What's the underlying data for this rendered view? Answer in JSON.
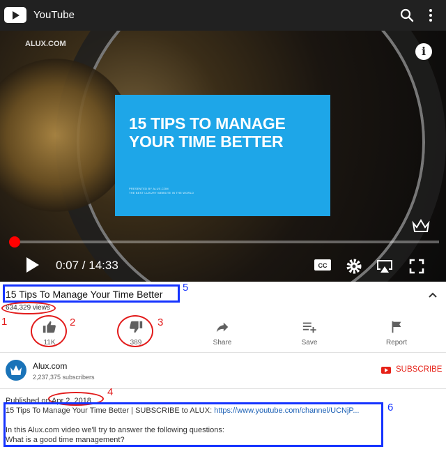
{
  "app": {
    "title": "YouTube"
  },
  "player": {
    "watermark": "ALUX.COM",
    "card_title": "15 TIPS TO MANAGE YOUR TIME BETTER",
    "card_sub1": "PRESENTED BY ALUX.COM",
    "card_sub2": "THE BEST LUXURY WEBSITE IN THE WORLD",
    "time": "0:07 / 14:33",
    "progress": 0.008
  },
  "video": {
    "title": "15 Tips To Manage Your Time Better",
    "views": "634,329 views"
  },
  "actions": [
    {
      "name": "like-button",
      "icon": "thumbs-up-icon",
      "label": "11K"
    },
    {
      "name": "dislike-button",
      "icon": "thumbs-down-icon",
      "label": "389"
    },
    {
      "name": "share-button",
      "icon": "share-icon",
      "label": "Share"
    },
    {
      "name": "save-button",
      "icon": "playlist-add-icon",
      "label": "Save"
    },
    {
      "name": "report-button",
      "icon": "flag-icon",
      "label": "Report"
    }
  ],
  "channel": {
    "name": "Alux.com",
    "subscribers": "2,237,375 subscribers",
    "subscribe_label": "SUBSCRIBE"
  },
  "description": {
    "published": "Published on Apr 2, 2018",
    "line1_text": "15 Tips To Manage Your Time Better | SUBSCRIBE to ALUX: ",
    "line1_link": "https://www.youtube.com/channel/UCNjP...",
    "line2": "In this Alux.com video we'll try to answer the following questions:",
    "line3": "What is a good time management?"
  },
  "annotations": [
    "1",
    "2",
    "3",
    "4",
    "5",
    "6"
  ],
  "colors": {
    "accent": "#e62117",
    "annotation_blue": "#1533ff",
    "annotation_red": "#e21b1b",
    "card": "#1ea6e8",
    "topbar": "#212121"
  }
}
